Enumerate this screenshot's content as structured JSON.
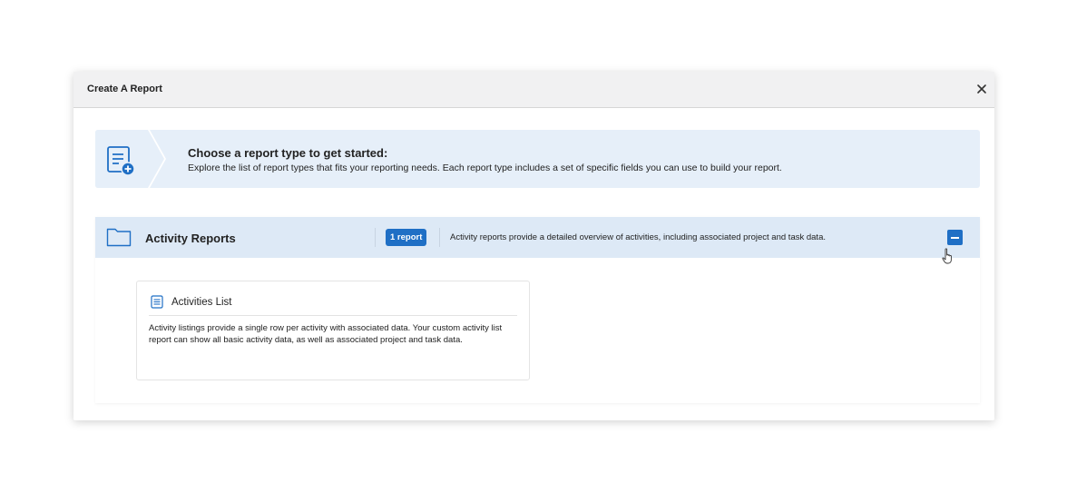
{
  "modal": {
    "title": "Create A Report",
    "close_icon": "close-icon"
  },
  "banner": {
    "heading": "Choose a report type to get started:",
    "text": "Explore the list of report types that fits your reporting needs. Each report type includes a set of specific fields you can use to build your report.",
    "icon": "report-add-icon"
  },
  "group": {
    "title": "Activity Reports",
    "badge": "1 report",
    "description": "Activity reports provide a detailed overview of activities, including associated project and task data.",
    "icon": "folder-icon",
    "collapse_icon": "collapse-minus-icon"
  },
  "card": {
    "title": "Activities List",
    "description": "Activity listings provide a single row per activity with associated data. Your custom activity list report can show all basic activity data, as well as associated project and task data.",
    "icon": "list-document-icon"
  },
  "colors": {
    "accent": "#1f6fc5",
    "banner_bg": "#e6eff9",
    "group_header_bg": "#dde9f6",
    "modal_header_bg": "#f1f1f2"
  }
}
